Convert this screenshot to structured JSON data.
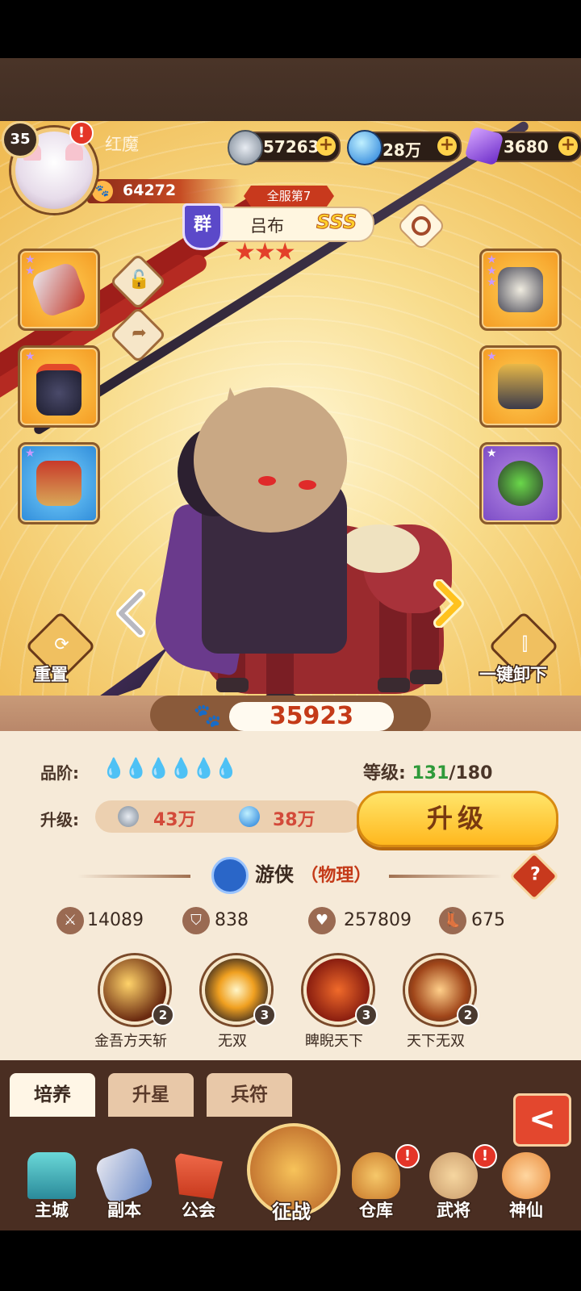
{
  "player": {
    "level": "35",
    "name": "红魔",
    "power": "64272"
  },
  "resources": [
    {
      "icon": "coin-icon",
      "value": "57263"
    },
    {
      "icon": "blue-orb-icon",
      "value": "28万"
    },
    {
      "icon": "purple-gem-icon",
      "value": "3680"
    }
  ],
  "hero": {
    "server_rank": "全服第7",
    "faction": "群",
    "name": "吕布",
    "grade": "SSS",
    "stars": "★★★",
    "combat_power": "35923"
  },
  "side_buttons": {
    "reset": "重置",
    "unequip_all": "一键卸下"
  },
  "info": {
    "quality_label": "品阶:",
    "quality_icons": "💧💧💧💧💧💧",
    "level_label": "等级:",
    "level_current": "131",
    "level_max": "/180",
    "upgrade_label": "升级:",
    "cost_coin": "43万",
    "cost_orb": "38万",
    "upgrade_button": "升级",
    "class_name": "游侠",
    "class_type": "（物理）",
    "help": "?"
  },
  "stats": [
    {
      "icon": "sword-icon",
      "value": "14089"
    },
    {
      "icon": "shield-icon",
      "value": "838"
    },
    {
      "icon": "heart-icon",
      "value": "257809"
    },
    {
      "icon": "boot-icon",
      "value": "675"
    }
  ],
  "skills": [
    {
      "name": "金吾方天斩",
      "level": "2"
    },
    {
      "name": "无双",
      "level": "3"
    },
    {
      "name": "睥睨天下",
      "level": "3"
    },
    {
      "name": "天下无双",
      "level": "2"
    }
  ],
  "tabs": [
    "培养",
    "升星",
    "兵符"
  ],
  "back_button": "<",
  "nav": [
    "主城",
    "副本",
    "公会",
    "征战",
    "仓库",
    "武将",
    "神仙"
  ],
  "alerts": {
    "avatar": "!",
    "warehouse": "!",
    "generals": "!"
  }
}
